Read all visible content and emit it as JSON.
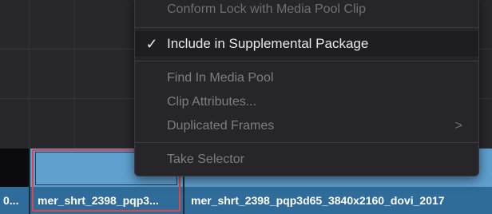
{
  "context_menu": {
    "items": {
      "conform_lock": "Conform Lock with Media Pool Clip",
      "include_supplemental": "Include in Supplemental Package",
      "find_in_media_pool": "Find In Media Pool",
      "clip_attributes": "Clip Attributes...",
      "duplicated_frames": "Duplicated Frames",
      "take_selector": "Take Selector"
    },
    "glyphs": {
      "check": "✓",
      "submenu_chevron": ">"
    },
    "checked_item": "include_supplemental"
  },
  "timeline": {
    "clips": [
      {
        "name": "0..."
      },
      {
        "name": "mer_shrt_2398_pqp3...",
        "selected": true
      },
      {
        "name": "mer_shrt_2398_pqp3d65_3840x2160_dovi_2017"
      }
    ]
  },
  "colors": {
    "clip_blue": "#5fa0d0",
    "clip_name_bar": "#2f6c99",
    "selection_red": "#e04444",
    "menu_bg": "#26262a",
    "menu_highlight_bg": "#1e1e22",
    "disabled_text": "#7d7d82"
  }
}
